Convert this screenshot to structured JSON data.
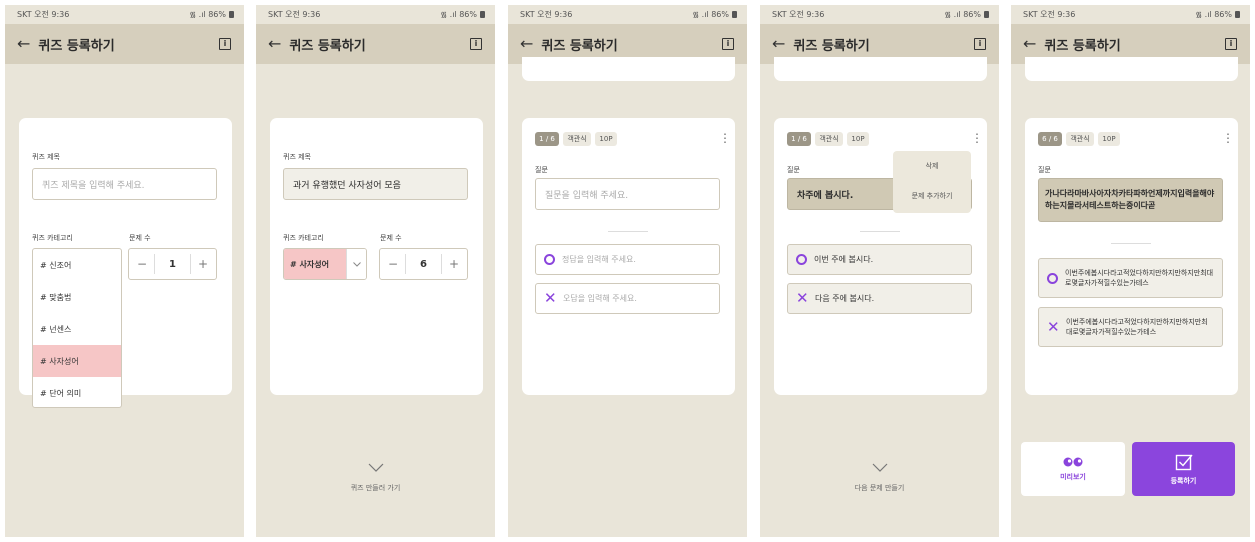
{
  "status": {
    "carrier_time": "SKT  오전 9:36",
    "signal": "᯾ .ıl 86%"
  },
  "header": {
    "back_icon": "←",
    "title": "퀴즈 등록하기",
    "info_icon": "i"
  },
  "screen1": {
    "title_label": "퀴즈 제목",
    "title_placeholder": "퀴즈 제목을 입력해 주세요.",
    "category_label": "퀴즈 카테고리",
    "count_label": "문제 수",
    "count_minus": "−",
    "count_value": "1",
    "count_plus": "+",
    "category_options": [
      "# 신조어",
      "# 맞춤법",
      "# 넌센스",
      "# 사자성어",
      "# 단어 의미"
    ],
    "selected_index": 3
  },
  "screen2": {
    "title_label": "퀴즈 제목",
    "title_value": "과거 유행했던 사자성어 모음",
    "category_label": "퀴즈 카테고리",
    "count_label": "문제 수",
    "category_value": "# 사자성어",
    "count_minus": "−",
    "count_value": "6",
    "count_plus": "+",
    "footer_hint": "퀴즈 만들러 가기"
  },
  "screen3": {
    "page": "1 / 6",
    "type": "객관식",
    "points": "10P",
    "question_label": "질문",
    "question_placeholder": "질문을 입력해 주세요.",
    "answer_correct_placeholder": "정답을 입력해 주세요.",
    "answer_wrong_placeholder": "오답을 입력해 주세요."
  },
  "screen4": {
    "page": "1 / 6",
    "type": "객관식",
    "points": "10P",
    "question_label": "질문",
    "question_value": "차주에 봅시다.",
    "menu": [
      "삭제",
      "문제 추가하기"
    ],
    "answer_correct": "이번 주에 봅시다.",
    "answer_wrong": "다음 주에 봅시다.",
    "footer_hint": "다음 문제 만들기"
  },
  "screen5": {
    "page": "6 / 6",
    "type": "객관식",
    "points": "10P",
    "question_label": "질문",
    "question_value": "가나다라마바사아자차카타파하언제까지입력을해야하는지몰라서테스트하는중이다곧",
    "answer_correct": "이번주에봅시다라고적었다하지만하지만하지만최대로몇글자가적힐수있는가테스",
    "answer_wrong": "이번주에봅시다라고적었다하지만하지만하지만최대로몇글자가적힐수있는가테스",
    "preview_label": "미리보기",
    "register_label": "등록하기"
  },
  "colors": {
    "accent": "#8b45dd",
    "background": "#e9e5d9",
    "header": "#d6cfbd",
    "selected": "#f6c6c6"
  }
}
